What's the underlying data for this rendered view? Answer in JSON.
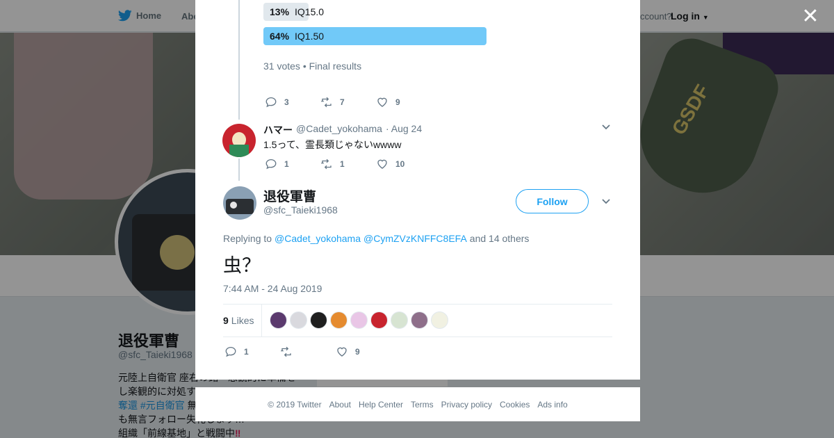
{
  "background": {
    "nav": {
      "home": "Home",
      "about": "Abo",
      "account": "ccount?",
      "login": "Log in"
    },
    "banner_patch_text": "GSDF",
    "profile": {
      "name": "退役軍曹",
      "handle": "@sfc_Taieki1968",
      "bio_line1": "元陸上自衛官 座右の銘「悲観的に準備を",
      "bio_line2": "し楽観的に対処す",
      "bio_tag1": "奪還",
      "bio_tag2": "#元自衛官",
      "bio_line3_rest": " 無",
      "bio_line4": "も無言フォロー失礼します…",
      "bio_line5": "組織「前線基地」と戦闘中",
      "bio_exclaim": "‼"
    }
  },
  "overlay": {
    "close_icon": "close-icon"
  },
  "poll": {
    "options": [
      {
        "percent": "13%",
        "label": "IQ15.0",
        "winner": false,
        "share": 0.13
      },
      {
        "percent": "64%",
        "label": "IQ1.50",
        "winner": true,
        "share": 0.64
      }
    ],
    "meta": "31 votes • Final results"
  },
  "prev_tweet_actions": {
    "replies": "3",
    "retweets": "7",
    "likes": "9"
  },
  "reply_tweet": {
    "display_name": "ハマー",
    "handle": "@Cadet_yokohama",
    "date": "· Aug 24",
    "text": "1.5って、霊長類じゃないwwww",
    "actions": {
      "replies": "1",
      "retweets": "1",
      "likes": "10"
    }
  },
  "main_tweet": {
    "display_name": "退役軍曹",
    "handle": "@sfc_Taieki1968",
    "follow_label": "Follow",
    "replying_prefix": "Replying to",
    "replying_user1": "@Cadet_yokohama",
    "replying_user2": "@CymZVzKNFFC8EFA",
    "replying_suffix": "and 14 others",
    "text": "虫？",
    "timestamp": "7:44 AM - 24 Aug 2019",
    "likes_count": "9",
    "likes_label": "Likes",
    "liker_colors": [
      "#5b3a6e",
      "#d9d9de",
      "#1f1f1f",
      "#e58b2f",
      "#e9c6e6",
      "#c8242e",
      "#d7e4d2",
      "#8e6f8a",
      "#f1f1e2"
    ],
    "actions": {
      "replies": "1",
      "retweets": "",
      "likes": "9"
    }
  },
  "footer": {
    "copyright": "© 2019 Twitter",
    "links": [
      "About",
      "Help Center",
      "Terms",
      "Privacy policy",
      "Cookies",
      "Ads info"
    ]
  },
  "colors": {
    "accent": "#1da1f2",
    "poll_winner": "#71c9f8",
    "poll_loser": "#e1e8ed"
  }
}
